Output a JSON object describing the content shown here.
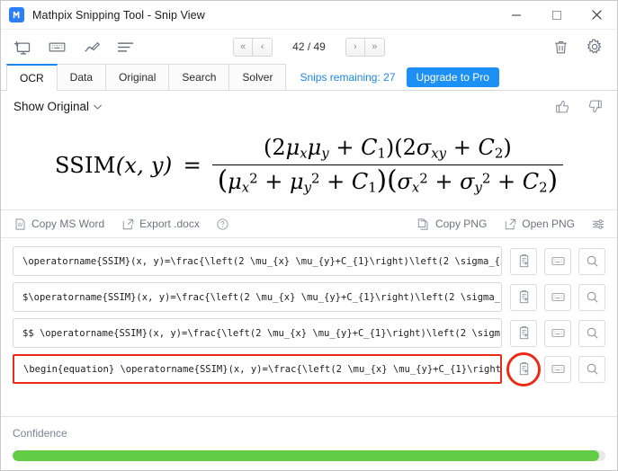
{
  "window": {
    "title": "Mathpix Snipping Tool - Snip View",
    "logo_glyph": "Ⓜ",
    "logo_text": "ℓ",
    "minimize_label": "minimize",
    "maximize_label": "maximize",
    "close_label": "close"
  },
  "toolbar": {
    "icons": [
      {
        "name": "new-snip-icon",
        "label": "New Snip"
      },
      {
        "name": "keyboard-shortcut-icon",
        "label": "Keyboard"
      },
      {
        "name": "draw-icon",
        "label": "Draw"
      },
      {
        "name": "text-lines-icon",
        "label": "Text Lines"
      }
    ],
    "pager": {
      "first_label": "«",
      "prev_label": "‹",
      "count": "42 / 49",
      "next_label": "›",
      "last_label": "»"
    },
    "right_icons": [
      {
        "name": "trash-icon",
        "label": "Delete"
      },
      {
        "name": "gear-icon",
        "label": "Settings"
      }
    ]
  },
  "tabs": [
    {
      "label": "OCR",
      "active": true
    },
    {
      "label": "Data",
      "active": false
    },
    {
      "label": "Original",
      "active": false
    },
    {
      "label": "Search",
      "active": false
    },
    {
      "label": "Solver",
      "active": false
    }
  ],
  "snips": {
    "remaining_text": "Snips remaining: 27",
    "upgrade_label": "Upgrade to Pro",
    "accent_color": "#1c90f5"
  },
  "show_original": {
    "label": "Show Original",
    "chevron": "⌄"
  },
  "feedback": {
    "thumbs_up": "thumbs-up-icon",
    "thumbs_down": "thumbs-down-icon"
  },
  "formula": {
    "lhs": "SSIM",
    "args": "(x, y)",
    "equals": "=",
    "numerator": "(2μₓμᵧ + C₁)(2σₓᵧ + C₂)",
    "denominator": "(μₓ² + μᵧ² + C₁)(σₓ² + σᵧ² + C₂)"
  },
  "actions": {
    "copy_ms_word": "Copy MS Word",
    "export_docx": "Export .docx",
    "help": "?",
    "copy_png": "Copy PNG",
    "open_png": "Open PNG",
    "settings_icon": "sliders-icon"
  },
  "latex_rows": [
    {
      "text": "\\operatorname{SSIM}(x, y)=\\frac{\\left(2 \\mu_{x} \\mu_{y}+C_{1}\\right)\\left(2 \\sigma_{x",
      "highlighted": false,
      "copy_circled": false
    },
    {
      "text": "$\\operatorname{SSIM}(x, y)=\\frac{\\left(2 \\mu_{x} \\mu_{y}+C_{1}\\right)\\left(2 \\sigma_{",
      "highlighted": false,
      "copy_circled": false
    },
    {
      "text": "$$  \\operatorname{SSIM}(x, y)=\\frac{\\left(2 \\mu_{x} \\mu_{y}+C_{1}\\right)\\left(2 \\sigm",
      "highlighted": false,
      "copy_circled": false
    },
    {
      "text": "\\begin{equation}  \\operatorname{SSIM}(x, y)=\\frac{\\left(2 \\mu_{x} \\mu_{y}+C_{1}\\right",
      "highlighted": true,
      "copy_circled": true
    }
  ],
  "row_buttons": {
    "copy_label": "copy-to-clipboard",
    "keyboard_label": "keyboard",
    "search_label": "search"
  },
  "confidence": {
    "label": "Confidence",
    "percent": 99,
    "color": "#63cc46"
  },
  "highlight_color": "#ec2a16"
}
